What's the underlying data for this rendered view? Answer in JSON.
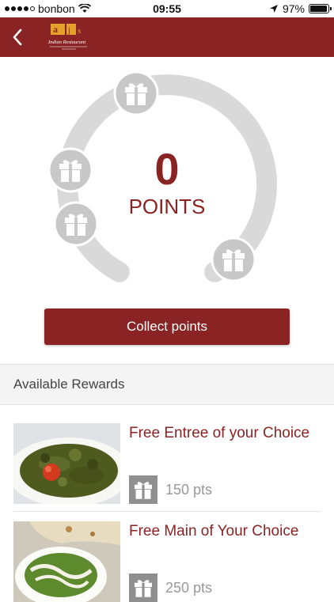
{
  "status_bar": {
    "carrier": "bonbon",
    "time": "09:55",
    "battery": "97%",
    "battery_level": 0.97,
    "icons": [
      "signal-dots-icon",
      "wifi-icon",
      "location-arrow-icon",
      "battery-icon"
    ]
  },
  "nav": {
    "back_icon": "chevron-left-icon",
    "logo_alt": "restaurant-logo"
  },
  "loyalty": {
    "points": "0",
    "points_label": "POINTS",
    "collect_label": "Collect points",
    "gift_icon": "gift-icon"
  },
  "rewards": {
    "heading": "Available Rewards",
    "items": [
      {
        "title": "Free Entree of your Choice",
        "points": "150 pts",
        "image": "spinach-curry-photo"
      },
      {
        "title": "Free Main of Your Choice",
        "points": "250 pts",
        "image": "palak-dish-with-naan-photo"
      }
    ]
  },
  "colors": {
    "brand": "#8a2424",
    "track": "#d9d9d9",
    "badge": "#8f8f8f"
  }
}
